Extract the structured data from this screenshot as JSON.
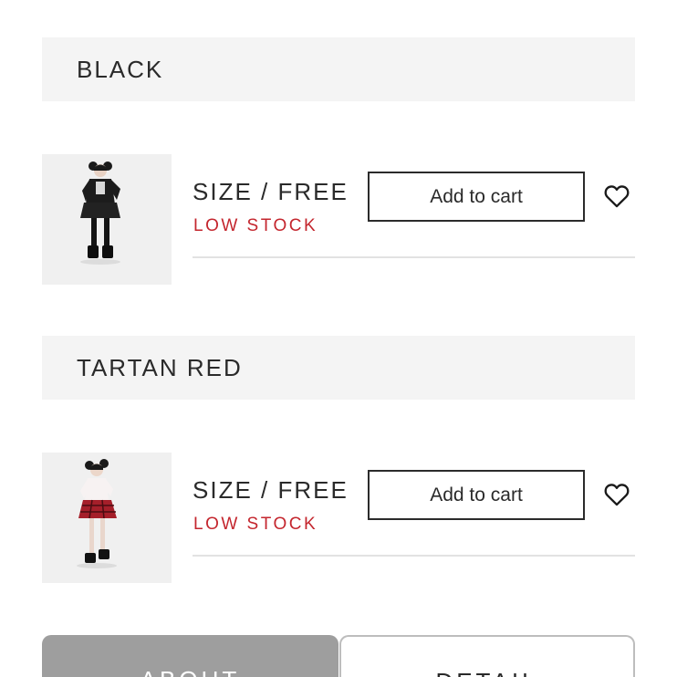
{
  "variants": [
    {
      "color_name": "BLACK",
      "size_label": "SIZE / FREE",
      "stock_status": "LOW STOCK",
      "cart_label": "Add to cart",
      "favorite_icon": "heart-outline-icon"
    },
    {
      "color_name": "TARTAN RED",
      "size_label": "SIZE / FREE",
      "stock_status": "LOW STOCK",
      "cart_label": "Add to cart",
      "favorite_icon": "heart-outline-icon"
    }
  ],
  "tabs": [
    {
      "label": "ABOUT",
      "active": true
    },
    {
      "label": "DETAIL",
      "active": false
    }
  ],
  "colors": {
    "stock_red": "#c4262e",
    "header_bg": "#f4f4f4",
    "active_tab_bg": "#9e9e9e"
  }
}
